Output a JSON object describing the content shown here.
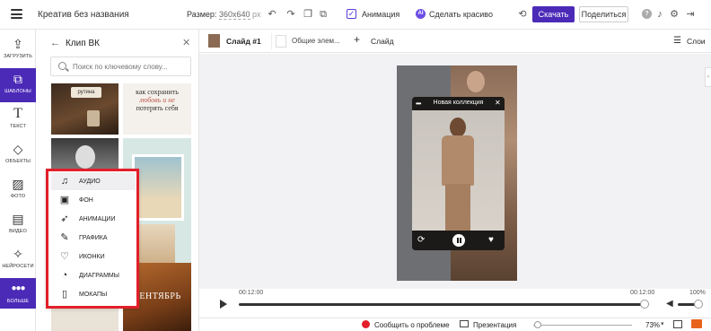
{
  "app": {
    "project_title": "Креатив без названия",
    "size_label": "Размер:",
    "size_value": "360x640",
    "size_unit": "px",
    "animation_label": "Анимация",
    "animation_checked": true,
    "make_beautiful_label": "Сделать красиво",
    "ai_badge": "AI",
    "download_label": "Скачать",
    "share_label": "Поделиться",
    "accent_color": "#4b2ab8",
    "highlight_color": "#e21f2a"
  },
  "rail": {
    "items": [
      {
        "label": "ЗАГРУЗИТЬ",
        "icon": "upload-icon"
      },
      {
        "label": "ШАБЛОНЫ",
        "icon": "templates-icon",
        "active": true
      },
      {
        "label": "ТЕКСТ",
        "icon": "text-icon"
      },
      {
        "label": "ОБЪЕКТЫ",
        "icon": "objects-icon"
      },
      {
        "label": "ФОТО",
        "icon": "photo-icon"
      },
      {
        "label": "ВИДЕО",
        "icon": "video-icon"
      },
      {
        "label": "НЕЙРОСЕТИ",
        "icon": "ai-wand-icon"
      },
      {
        "label": "БОЛЬШЕ",
        "icon": "more-dots-icon"
      }
    ]
  },
  "panel": {
    "title": "Клип ВК",
    "search_placeholder": "Поиск по ключевому слову...",
    "thumb_texts": {
      "rutina": "рутина",
      "quote_line1": "как сохранить",
      "quote_line2": "любовь и не",
      "quote_line3": "потерять себя",
      "september": "СЕНТЯБРЬ"
    }
  },
  "popup_menu": {
    "items": [
      {
        "label": "АУДИО",
        "icon": "audio-note-icon",
        "hover": true
      },
      {
        "label": "ФОН",
        "icon": "background-icon"
      },
      {
        "label": "АНИМАЦИИ",
        "icon": "rocket-icon"
      },
      {
        "label": "ГРАФИКА",
        "icon": "brush-icon"
      },
      {
        "label": "ИКОНКИ",
        "icon": "heart-icon"
      },
      {
        "label": "ДИАГРАММЫ",
        "icon": "pie-chart-icon"
      },
      {
        "label": "МОКАПЫ",
        "icon": "phone-mockup-icon"
      }
    ]
  },
  "slides": {
    "current_label": "Слайд #1",
    "second_label": "Общие элем...",
    "add_label": "Слайд",
    "layers_label": "Слои"
  },
  "player": {
    "title": "Новая коллекция"
  },
  "timeline": {
    "start_time": "00:12:00",
    "end_time": "00:12:00",
    "volume": "100%",
    "progress": 1.0,
    "volume_level": 1.0
  },
  "statusbar": {
    "report_label": "Сообщить о проблеме",
    "presentation_label": "Презентация",
    "zoom": "73%"
  }
}
